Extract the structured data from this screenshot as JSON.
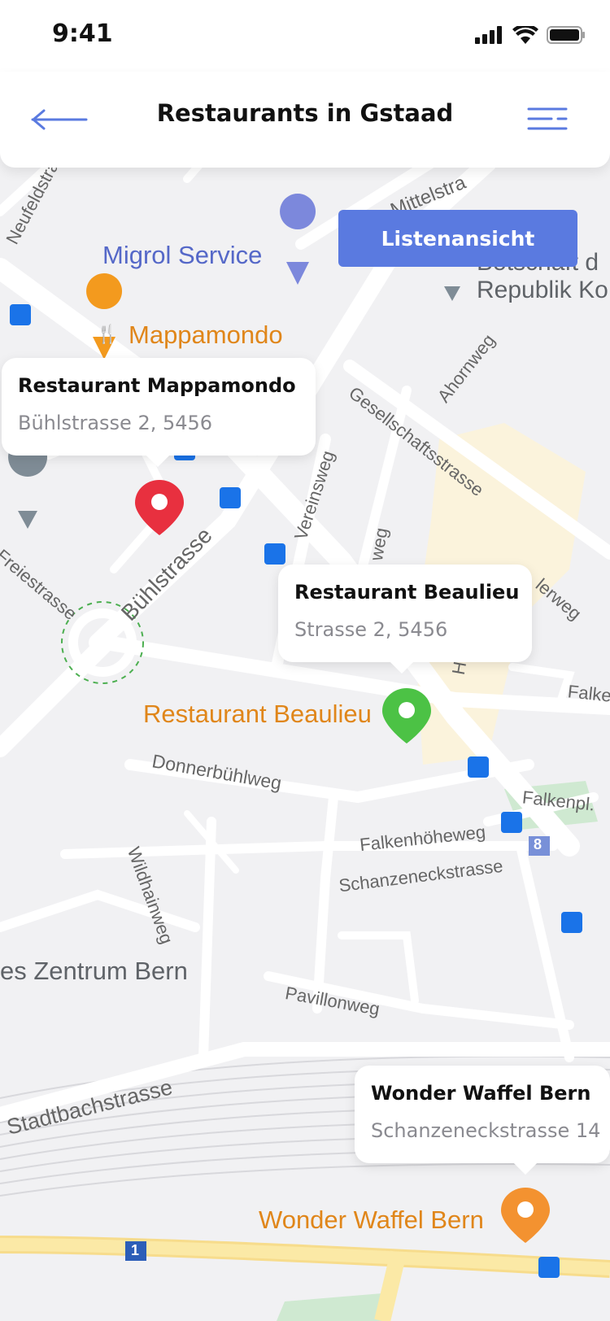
{
  "status": {
    "time": "9:41"
  },
  "header": {
    "title": "Restaurants in Gstaad"
  },
  "map": {
    "list_view_label": "Listenansicht",
    "poi": {
      "migrol": "Migrol Service",
      "mappamondo": "Mappamondo",
      "beaulieu": "Restaurant Beaulieu",
      "wonder_waffel": "Wonder Waffel Bern",
      "botschaft_1": "Botschaft d",
      "botschaft_2": "Republik Ko",
      "zentrum": "es Zentrum Bern"
    },
    "streets": {
      "mittelstr": "Mittelstra",
      "neufeldstr": "Neufeldstra",
      "ahornweg": "Ahornweg",
      "gesellschaft": "Gesellschaftsstrasse",
      "vereinsweg": "Vereinsweg",
      "buehlstrasse": "Bühlstrasse",
      "freiestrasse": "Freiestrasse",
      "donnerbuehlweg": "Donnerbühlweg",
      "falkenhoeheweg": "Falkenhöheweg",
      "schanzeneck": "Schanzeneckstrasse",
      "falkenpl": "Falkenpl.",
      "falke": "Falke",
      "erweg": "lerweg",
      "wildhainweg": "Wildhainweg",
      "pavillonweg": "Pavillonweg",
      "stadtbach": "Stadtbachstrasse",
      "hal": "Hal",
      "eg": "weg",
      "route_8": "8",
      "route_1": "1"
    },
    "pins": [
      {
        "name": "Restaurant Mappamondo",
        "address": "Bühlstrasse 2, 5456",
        "color": "#e8303f"
      },
      {
        "name": "Restaurant Beaulieu",
        "address": "Strasse 2, 5456",
        "color": "#4cc245"
      },
      {
        "name": "Wonder Waffel Bern",
        "address": "Schanzeneckstrasse 14",
        "color": "#f39230"
      }
    ],
    "colors": {
      "accent": "#5a7ae0",
      "poi_orange": "#e0861a",
      "poi_blue": "#5568c8",
      "label_gray": "#5f6368"
    }
  }
}
